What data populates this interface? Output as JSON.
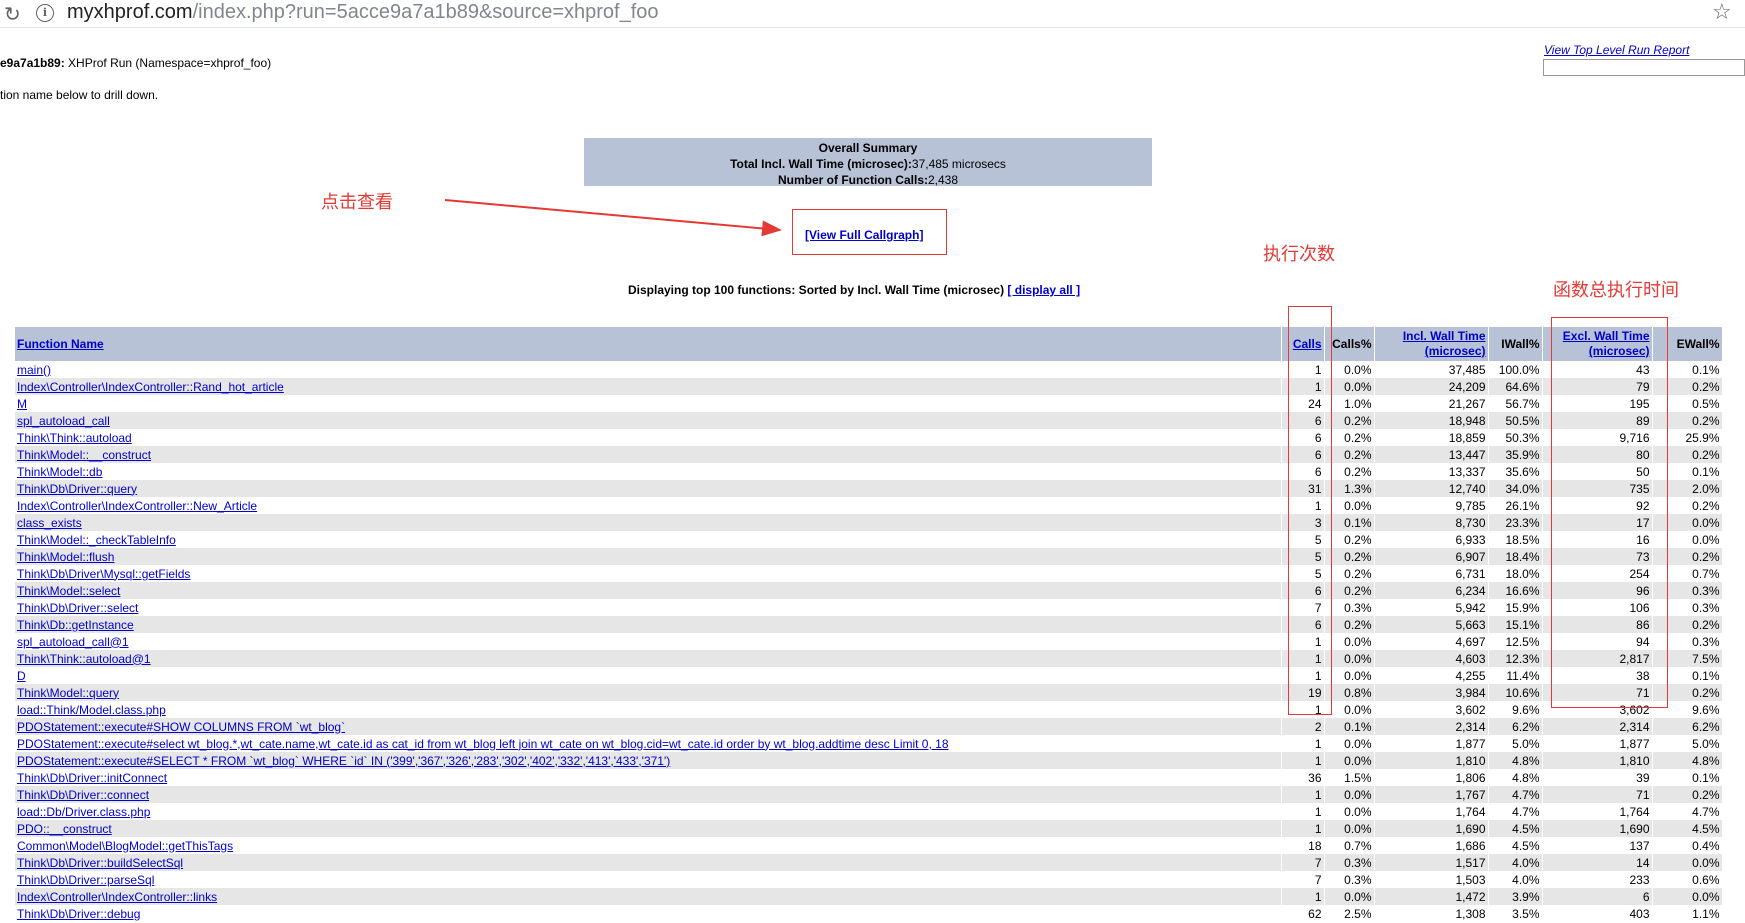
{
  "browser": {
    "url_host": "myxhprof.com",
    "url_path": "/index.php?run=5acce9a7a1b89&source=xhprof_foo",
    "reload_icon": "reload-icon",
    "info_icon": "info-icon",
    "star_icon": "star-icon"
  },
  "header": {
    "run_id": "e9a7a1b89:",
    "run_title": " XHProf Run (Namespace=xhprof_foo)",
    "drill_text": "tion name below to drill down.",
    "top_report_link": "View Top Level Run Report"
  },
  "summary": {
    "title": "Overall Summary",
    "wall_label": "Total Incl. Wall Time (microsec):",
    "wall_value": "37,485 microsecs",
    "calls_label": "Number of Function Calls:",
    "calls_value": "2,438"
  },
  "callgraph_link": "[View Full Callgraph]",
  "displaying": {
    "text": "Displaying top 100 functions: Sorted by Incl. Wall Time (microsec) ",
    "link": "[ display all ]"
  },
  "annotations": {
    "click_view": "点击查看",
    "exec_count": "执行次数",
    "total_time": "函数总执行时间"
  },
  "colors": {
    "annotation_red": "#e53935",
    "header_bg": "#b8c2d6",
    "link_blue": "#0000cc",
    "row_alt": "#e6e6e6"
  },
  "table": {
    "headers": {
      "function_name": "Function Name",
      "calls": "Calls",
      "calls_pct": "Calls%",
      "incl_wall_1": "Incl. Wall Time",
      "incl_wall_2": "(microsec)",
      "iwall_pct": "IWall%",
      "excl_wall_1": "Excl. Wall Time",
      "excl_wall_2": "(microsec)",
      "ewall_pct": "EWall%"
    },
    "rows": [
      [
        "main()",
        "1",
        "0.0%",
        "37,485",
        "100.0%",
        "43",
        "0.1%"
      ],
      [
        "Index\\Controller\\IndexController::Rand_hot_article",
        "1",
        "0.0%",
        "24,209",
        "64.6%",
        "79",
        "0.2%"
      ],
      [
        "M",
        "24",
        "1.0%",
        "21,267",
        "56.7%",
        "195",
        "0.5%"
      ],
      [
        "spl_autoload_call",
        "6",
        "0.2%",
        "18,948",
        "50.5%",
        "89",
        "0.2%"
      ],
      [
        "Think\\Think::autoload",
        "6",
        "0.2%",
        "18,859",
        "50.3%",
        "9,716",
        "25.9%"
      ],
      [
        "Think\\Model::__construct",
        "6",
        "0.2%",
        "13,447",
        "35.9%",
        "80",
        "0.2%"
      ],
      [
        "Think\\Model::db",
        "6",
        "0.2%",
        "13,337",
        "35.6%",
        "50",
        "0.1%"
      ],
      [
        "Think\\Db\\Driver::query",
        "31",
        "1.3%",
        "12,740",
        "34.0%",
        "735",
        "2.0%"
      ],
      [
        "Index\\Controller\\IndexController::New_Article",
        "1",
        "0.0%",
        "9,785",
        "26.1%",
        "92",
        "0.2%"
      ],
      [
        "class_exists",
        "3",
        "0.1%",
        "8,730",
        "23.3%",
        "17",
        "0.0%"
      ],
      [
        "Think\\Model::_checkTableInfo",
        "5",
        "0.2%",
        "6,933",
        "18.5%",
        "16",
        "0.0%"
      ],
      [
        "Think\\Model::flush",
        "5",
        "0.2%",
        "6,907",
        "18.4%",
        "73",
        "0.2%"
      ],
      [
        "Think\\Db\\Driver\\Mysql::getFields",
        "5",
        "0.2%",
        "6,731",
        "18.0%",
        "254",
        "0.7%"
      ],
      [
        "Think\\Model::select",
        "6",
        "0.2%",
        "6,234",
        "16.6%",
        "96",
        "0.3%"
      ],
      [
        "Think\\Db\\Driver::select",
        "7",
        "0.3%",
        "5,942",
        "15.9%",
        "106",
        "0.3%"
      ],
      [
        "Think\\Db::getInstance",
        "6",
        "0.2%",
        "5,663",
        "15.1%",
        "86",
        "0.2%"
      ],
      [
        "spl_autoload_call@1",
        "1",
        "0.0%",
        "4,697",
        "12.5%",
        "94",
        "0.3%"
      ],
      [
        "Think\\Think::autoload@1",
        "1",
        "0.0%",
        "4,603",
        "12.3%",
        "2,817",
        "7.5%"
      ],
      [
        "D",
        "1",
        "0.0%",
        "4,255",
        "11.4%",
        "38",
        "0.1%"
      ],
      [
        "Think\\Model::query",
        "19",
        "0.8%",
        "3,984",
        "10.6%",
        "71",
        "0.2%"
      ],
      [
        "load::Think/Model.class.php",
        "1",
        "0.0%",
        "3,602",
        "9.6%",
        "3,602",
        "9.6%"
      ],
      [
        "PDOStatement::execute#SHOW COLUMNS FROM `wt_blog`",
        "2",
        "0.1%",
        "2,314",
        "6.2%",
        "2,314",
        "6.2%"
      ],
      [
        "PDOStatement::execute#select wt_blog.*,wt_cate.name,wt_cate.id as cat_id from wt_blog left join wt_cate on wt_blog.cid=wt_cate.id order by wt_blog.addtime desc Limit 0, 18",
        "1",
        "0.0%",
        "1,877",
        "5.0%",
        "1,877",
        "5.0%"
      ],
      [
        "PDOStatement::execute#SELECT * FROM `wt_blog` WHERE `id` IN ('399','367','326','283','302','402','332','413','433','371')",
        "1",
        "0.0%",
        "1,810",
        "4.8%",
        "1,810",
        "4.8%"
      ],
      [
        "Think\\Db\\Driver::initConnect",
        "36",
        "1.5%",
        "1,806",
        "4.8%",
        "39",
        "0.1%"
      ],
      [
        "Think\\Db\\Driver::connect",
        "1",
        "0.0%",
        "1,767",
        "4.7%",
        "71",
        "0.2%"
      ],
      [
        "load::Db/Driver.class.php",
        "1",
        "0.0%",
        "1,764",
        "4.7%",
        "1,764",
        "4.7%"
      ],
      [
        "PDO::__construct",
        "1",
        "0.0%",
        "1,690",
        "4.5%",
        "1,690",
        "4.5%"
      ],
      [
        "Common\\Model\\BlogModel::getThisTags",
        "18",
        "0.7%",
        "1,686",
        "4.5%",
        "137",
        "0.4%"
      ],
      [
        "Think\\Db\\Driver::buildSelectSql",
        "7",
        "0.3%",
        "1,517",
        "4.0%",
        "14",
        "0.0%"
      ],
      [
        "Think\\Db\\Driver::parseSql",
        "7",
        "0.3%",
        "1,503",
        "4.0%",
        "233",
        "0.6%"
      ],
      [
        "Index\\Controller\\IndexController::links",
        "1",
        "0.0%",
        "1,472",
        "3.9%",
        "6",
        "0.0%"
      ],
      [
        "Think\\Db\\Driver::debug",
        "62",
        "2.5%",
        "1,308",
        "3.5%",
        "403",
        "1.1%"
      ]
    ]
  }
}
